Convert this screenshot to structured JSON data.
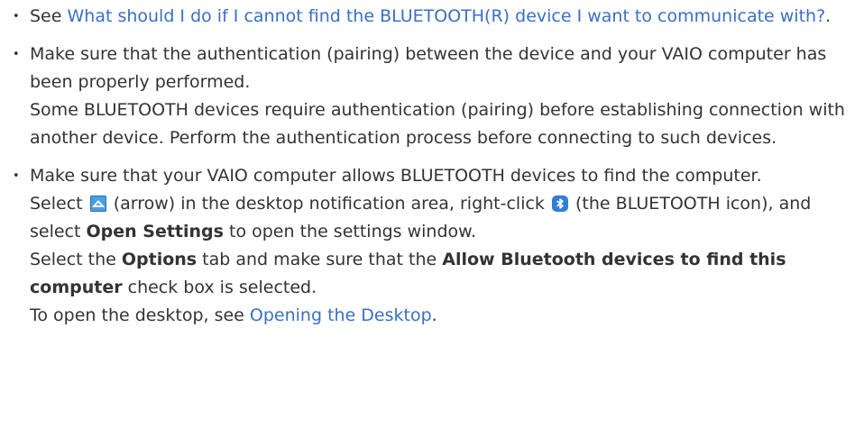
{
  "items": [
    {
      "prefix": "See ",
      "link": "What should I do if I cannot find the BLUETOOTH(R) device I want to communicate with?",
      "suffix": "."
    },
    {
      "line1": "Make sure that the authentication (pairing) between the device and your VAIO computer has been properly performed.",
      "line2": "Some BLUETOOTH devices require authentication (pairing) before establishing connection with another device. Perform the authentication process before connecting to such devices."
    },
    {
      "line1": "Make sure that your VAIO computer allows BLUETOOTH devices to find the computer.",
      "p2_a": "Select ",
      "p2_b": " (arrow) in the desktop notification area, right-click ",
      "p2_c": " (the BLUETOOTH icon), and select ",
      "p2_bold": "Open Settings",
      "p2_d": " to open the settings window.",
      "p3_a": "Select the ",
      "p3_bold1": "Options",
      "p3_b": " tab and make sure that the ",
      "p3_bold2": "Allow Bluetooth devices to find this computer",
      "p3_c": " check box is selected.",
      "p4_a": "To open the desktop, see ",
      "p4_link": "Opening the Desktop",
      "p4_b": "."
    }
  ],
  "icons": [
    "arrow-up-icon",
    "bluetooth-icon"
  ],
  "colors": {
    "text": "#333333",
    "link": "#3a6fc4",
    "arrow_bg": "#4a9fe0",
    "bluetooth_bg": "#2f7fd6"
  }
}
